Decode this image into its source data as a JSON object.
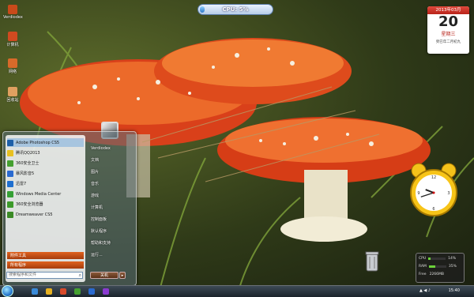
{
  "desktop": {
    "icons": [
      {
        "label": "Verdiodex",
        "color": "#c84a1a"
      },
      {
        "label": "计算机",
        "color": "#d04a20"
      },
      {
        "label": "网络",
        "color": "#d86a2a"
      },
      {
        "label": "回收站",
        "color": "#e0a060"
      }
    ]
  },
  "cpu_gadget": {
    "text": "CPU: 5%",
    "level": 0.05
  },
  "calendar": {
    "header": "2013年03月",
    "day": "20",
    "weekday": "星期三",
    "lunar": "癸巳年二月初九"
  },
  "clock": {
    "hour": 9,
    "minute": 42
  },
  "start_menu": {
    "programs": [
      {
        "label": "Adobe Photoshop CS5",
        "color": "#1d5fa8"
      },
      {
        "label": "腾讯QQ2013",
        "color": "#e8c020"
      },
      {
        "label": "360安全卫士",
        "color": "#45a030"
      },
      {
        "label": "暴风影音5",
        "color": "#2a6ad0"
      },
      {
        "label": "迅雷7",
        "color": "#1e6fcf"
      },
      {
        "label": "Windows Media Center",
        "color": "#35a035"
      },
      {
        "label": "360安全浏览器",
        "color": "#3c9a2a"
      },
      {
        "label": "Dreamweaver CS5",
        "color": "#3b8a26"
      }
    ],
    "pinned_highlight": "附件工具",
    "all_programs": "所有程序",
    "search_placeholder": "搜索程序和文件",
    "right_items": [
      "Verdiodex",
      "文档",
      "图片",
      "音乐",
      "游戏",
      "计算机",
      "控制面板",
      "默认程序",
      "帮助和支持",
      "运行..."
    ],
    "shutdown": "关机"
  },
  "sysmon": {
    "cpu_label": "CPU",
    "cpu_value": "14%",
    "cpu_level": 0.14,
    "ram_label": "RAM",
    "ram_value": "35%",
    "ram_level": 0.35,
    "free_label": "Free",
    "free_value": "2266MB"
  },
  "taskbar": {
    "time": "15:40",
    "tray": "▲ ◀ ♪"
  }
}
